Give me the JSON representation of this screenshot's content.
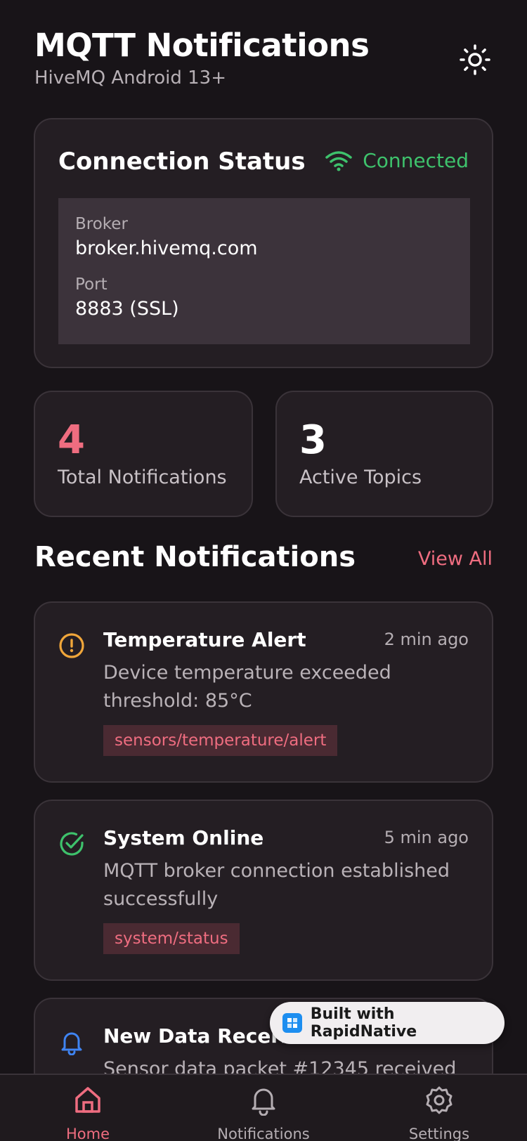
{
  "header": {
    "title": "MQTT Notifications",
    "subtitle": "HiveMQ Android 13+"
  },
  "connection": {
    "title": "Connection Status",
    "status": "Connected",
    "broker_label": "Broker",
    "broker_value": "broker.hivemq.com",
    "port_label": "Port",
    "port_value": "8883 (SSL)"
  },
  "stats": {
    "total_value": "4",
    "total_label": "Total Notifications",
    "topics_value": "3",
    "topics_label": "Active Topics"
  },
  "recent": {
    "title": "Recent Notifications",
    "view_all": "View All"
  },
  "notifications": [
    {
      "icon": "alert-circle-icon",
      "title": "Temperature Alert",
      "time": "2 min ago",
      "body": "Device temperature exceeded threshold: 85°C",
      "topic": "sensors/temperature/alert"
    },
    {
      "icon": "check-circle-icon",
      "title": "System Online",
      "time": "5 min ago",
      "body": "MQTT broker connection established successfully",
      "topic": "system/status"
    },
    {
      "icon": "bell-icon",
      "title": "New Data Received",
      "time": "",
      "body": "Sensor data packet #12345 received",
      "topic": ""
    }
  ],
  "tabs": [
    {
      "label": "Home",
      "icon": "home-icon"
    },
    {
      "label": "Notifications",
      "icon": "bell-icon"
    },
    {
      "label": "Settings",
      "icon": "gear-icon"
    }
  ],
  "badge": {
    "text": "Built with RapidNative"
  },
  "colors": {
    "accent": "#ef6d80",
    "success": "#3ec26c",
    "warning": "#f0a63a",
    "info": "#3f84f2"
  }
}
